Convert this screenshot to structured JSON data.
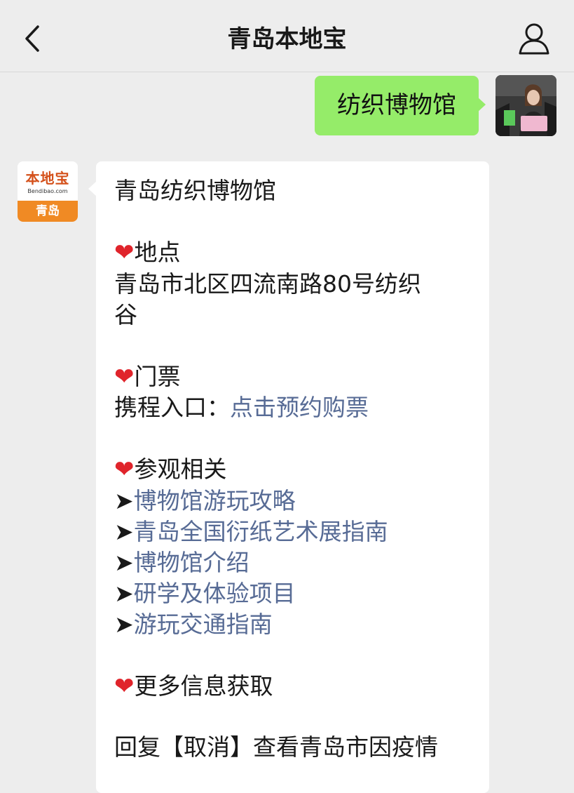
{
  "header": {
    "title": "青岛本地宝",
    "back_icon": "chevron-left-icon",
    "profile_icon": "person-icon"
  },
  "outgoing": {
    "text": "纺织博物馆"
  },
  "bot": {
    "logo_cn": "本地宝",
    "logo_en": "Bendibao.com",
    "logo_city": "青岛"
  },
  "reply": {
    "title": "青岛纺织博物馆",
    "heart": "❤",
    "location_heading": "地点",
    "location_line1": "青岛市北区四流南路80号纺织",
    "location_line2": "谷",
    "ticket_heading": "门票",
    "ticket_prefix": "携程入口：",
    "ticket_link": "点击预约购票",
    "visit_heading": "参观相关",
    "arrow": "➤",
    "visit_links": [
      "博物馆游玩攻略",
      "青岛全国衍纸艺术展指南",
      "博物馆介绍",
      "研学及体验项目",
      "游玩交通指南"
    ],
    "more_heading": "更多信息获取",
    "footer_line": "回复【取消】查看青岛市因疫情"
  },
  "colors": {
    "bubble_out": "#95ec69",
    "bubble_in": "#ffffff",
    "link": "#576b95",
    "heart": "#e0242b",
    "background": "#ededed"
  }
}
